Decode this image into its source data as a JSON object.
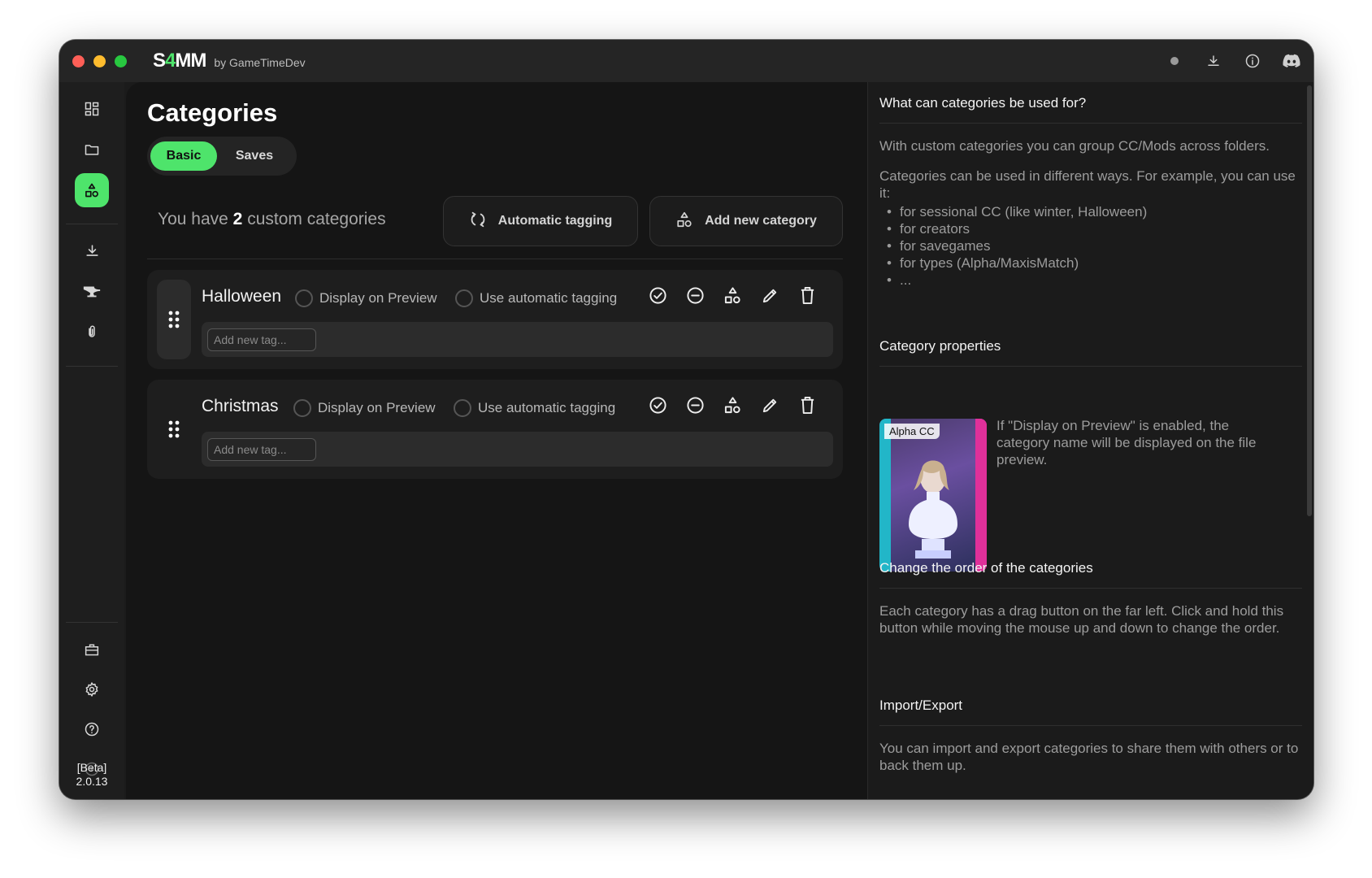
{
  "app": {
    "logo_pre": "S",
    "logo_four": "4",
    "logo_post": "MM",
    "byline": "by GameTimeDev",
    "accent": "#4ee46b",
    "title_icons": [
      "status-dot-icon",
      "download-icon",
      "info-icon",
      "discord-icon"
    ]
  },
  "sidebar": {
    "items": [
      {
        "icon": "dashboard-icon"
      },
      {
        "icon": "folder-icon"
      },
      {
        "icon": "categories-icon",
        "active": true
      },
      {
        "icon": "download-icon"
      },
      {
        "icon": "anvil-icon"
      },
      {
        "icon": "paperclip-icon"
      },
      {
        "icon": "toolbox-icon"
      },
      {
        "icon": "gear-icon"
      },
      {
        "icon": "help-icon"
      },
      {
        "icon": "play-icon"
      }
    ],
    "version_tag": "[Beta]",
    "version": "2.0.13"
  },
  "main": {
    "title": "Categories",
    "tabs": [
      {
        "label": "Basic",
        "active": true
      },
      {
        "label": "Saves",
        "active": false
      }
    ],
    "summary_pre": "You have",
    "summary_count": "2",
    "summary_post": "custom categories",
    "auto_tagging_label": "Automatic tagging",
    "add_category_label": "Add new category",
    "categories": [
      {
        "name": "Halloween",
        "display_on_preview_label": "Display on Preview",
        "display_on_preview": false,
        "auto_tagging_label": "Use automatic tagging",
        "auto_tagging": false,
        "tag_placeholder": "Add new tag..."
      },
      {
        "name": "Christmas",
        "display_on_preview_label": "Display on Preview",
        "display_on_preview": false,
        "auto_tagging_label": "Use automatic tagging",
        "auto_tagging": false,
        "tag_placeholder": "Add new tag..."
      }
    ],
    "action_icons": [
      "check-circle-icon",
      "minus-circle-icon",
      "shapes-icon",
      "pencil-icon",
      "trash-icon"
    ]
  },
  "help": {
    "s1_title": "What can categories be used for?",
    "s1_p1": "With custom categories you can group CC/Mods across folders.",
    "s1_p2": "Categories can be used in different ways. For example, you can use it:",
    "s1_list": [
      "for sessional CC (like winter, Halloween)",
      "for creators",
      "for savegames",
      "for types (Alpha/MaxisMatch)",
      "..."
    ],
    "s2_title": "Category properties",
    "s2_image_label": "Alpha CC",
    "s2_text": "If \"Display on Preview\" is enabled, the category name will be displayed on the file preview.",
    "s3_title": "Change the order of the categories",
    "s3_text": "Each category has a drag button on the far left. Click and hold this button while moving the mouse up and down to change the order.",
    "s4_title": "Import/Export",
    "s4_text": "You can import and export categories to share them with others or to back them up."
  }
}
